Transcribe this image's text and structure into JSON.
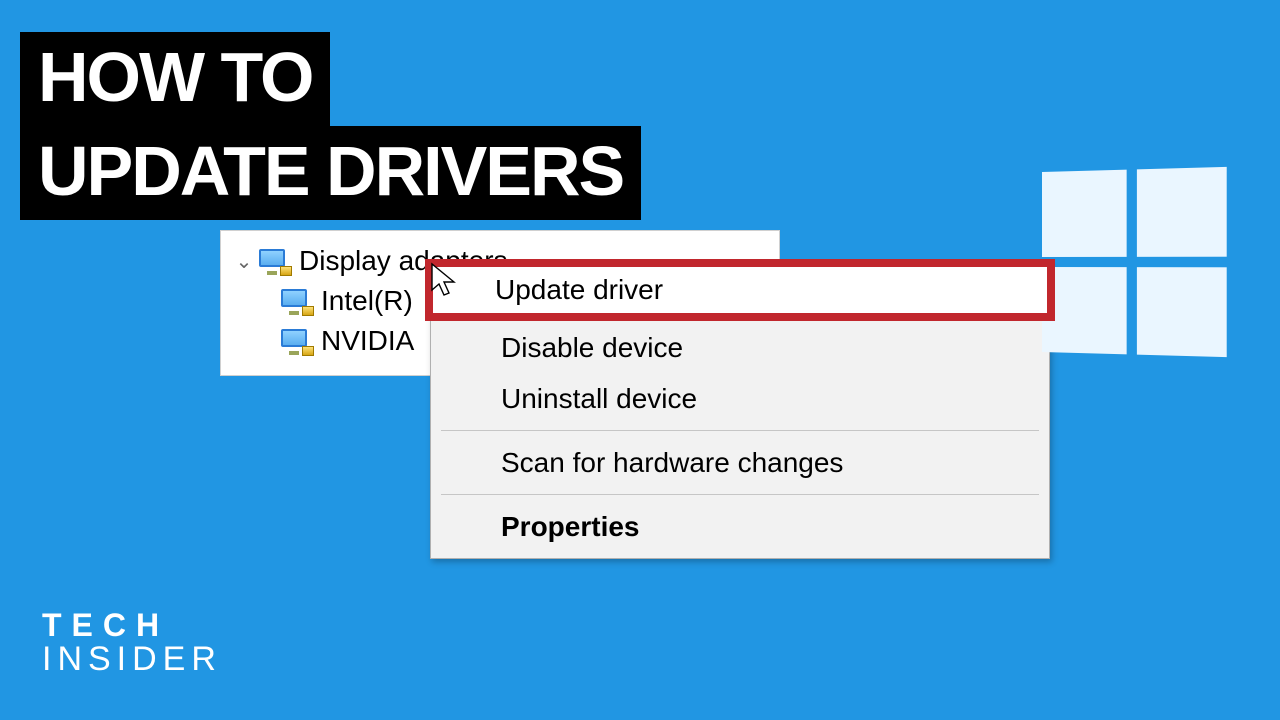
{
  "title": {
    "line1": "HOW TO",
    "line2": "UPDATE DRIVERS"
  },
  "tree": {
    "parent_label": "Display adapters",
    "children": [
      {
        "label": "Intel(R)"
      },
      {
        "label": "NVIDIA"
      }
    ]
  },
  "context_menu": {
    "items": [
      {
        "label": "Update driver",
        "highlighted": true
      },
      {
        "label": "Disable device",
        "highlighted": false
      },
      {
        "label": "Uninstall device",
        "highlighted": false
      },
      {
        "label": "Scan for hardware changes",
        "highlighted": false
      },
      {
        "label": "Properties",
        "highlighted": false,
        "bold": true
      }
    ]
  },
  "brand": {
    "line1": "TECH",
    "line2": "INSIDER"
  }
}
